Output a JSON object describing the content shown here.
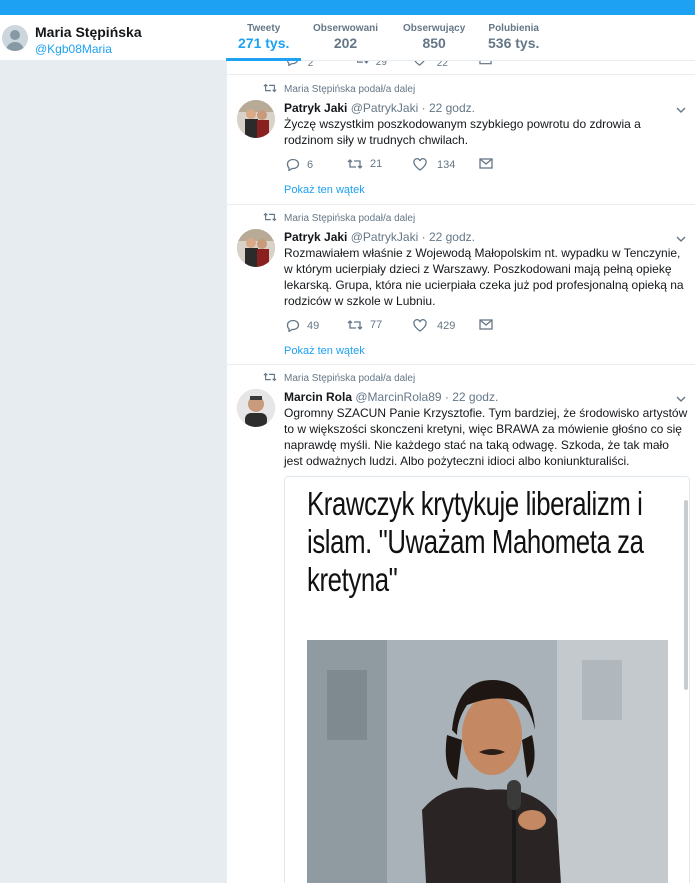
{
  "profile": {
    "name": "Maria Stępińska",
    "handle": "@Kgb08Maria",
    "avatar_icon": "default-profile-icon"
  },
  "stats": [
    {
      "label": "Tweety",
      "value": "271 tys.",
      "active": true
    },
    {
      "label": "Obserwowani",
      "value": "202",
      "active": false
    },
    {
      "label": "Obserwujący",
      "value": "850",
      "active": false
    },
    {
      "label": "Polubienia",
      "value": "536 tys.",
      "active": false
    }
  ],
  "previous_tweet_actions": {
    "replies": "2",
    "retweets": "29",
    "likes": "22"
  },
  "tweets": [
    {
      "retweeted_by": "Maria Stępińska podał/a dalej",
      "name": "Patryk Jaki",
      "handle": "@PatrykJaki",
      "time": "· 22 godz.",
      "text": "Życzę wszystkim poszkodowanym szybkiego powrotu do zdrowia a rodzinom siły w trudnych chwilach.",
      "replies": "6",
      "retweets": "21",
      "likes": "134",
      "thread_link": "Pokaż ten wątek"
    },
    {
      "retweeted_by": "Maria Stępińska podał/a dalej",
      "name": "Patryk Jaki",
      "handle": "@PatrykJaki",
      "time": "· 22 godz.",
      "text": "Rozmawiałem właśnie z Wojewodą Małopolskim nt. wypadku w Tenczynie, w którym ucierpiały dzieci z Warszawy. Poszkodowani mają pełną opiekę lekarską. Grupa, która nie ucierpiała czeka już pod profesjonalną opieką na rodziców w szkole w Lubniu.",
      "replies": "49",
      "retweets": "77",
      "likes": "429",
      "thread_link": "Pokaż ten wątek"
    },
    {
      "retweeted_by": "Maria Stępińska podał/a dalej",
      "name": "Marcin Rola",
      "handle": "@MarcinRola89",
      "time": "· 22 godz.",
      "text": "Ogromny SZACUN Panie Krzysztofie. Tym bardziej, że środowisko artystów to w większości skonczeni kretyni, więc BRAWA za mówienie głośno co się naprawdę myśli. Nie każdego stać na taką odwagę. Szkoda, że tak mało jest odważnych ludzi. Albo pożyteczni idioci albo koniunkturaliści.",
      "card_title": "Krawczyk krytykuje liberalizm i islam. \"Uważam Mahometa za kretyna\""
    }
  ],
  "colors": {
    "accent": "#1da1f2",
    "muted": "#657786",
    "background": "#e6ecf0"
  }
}
